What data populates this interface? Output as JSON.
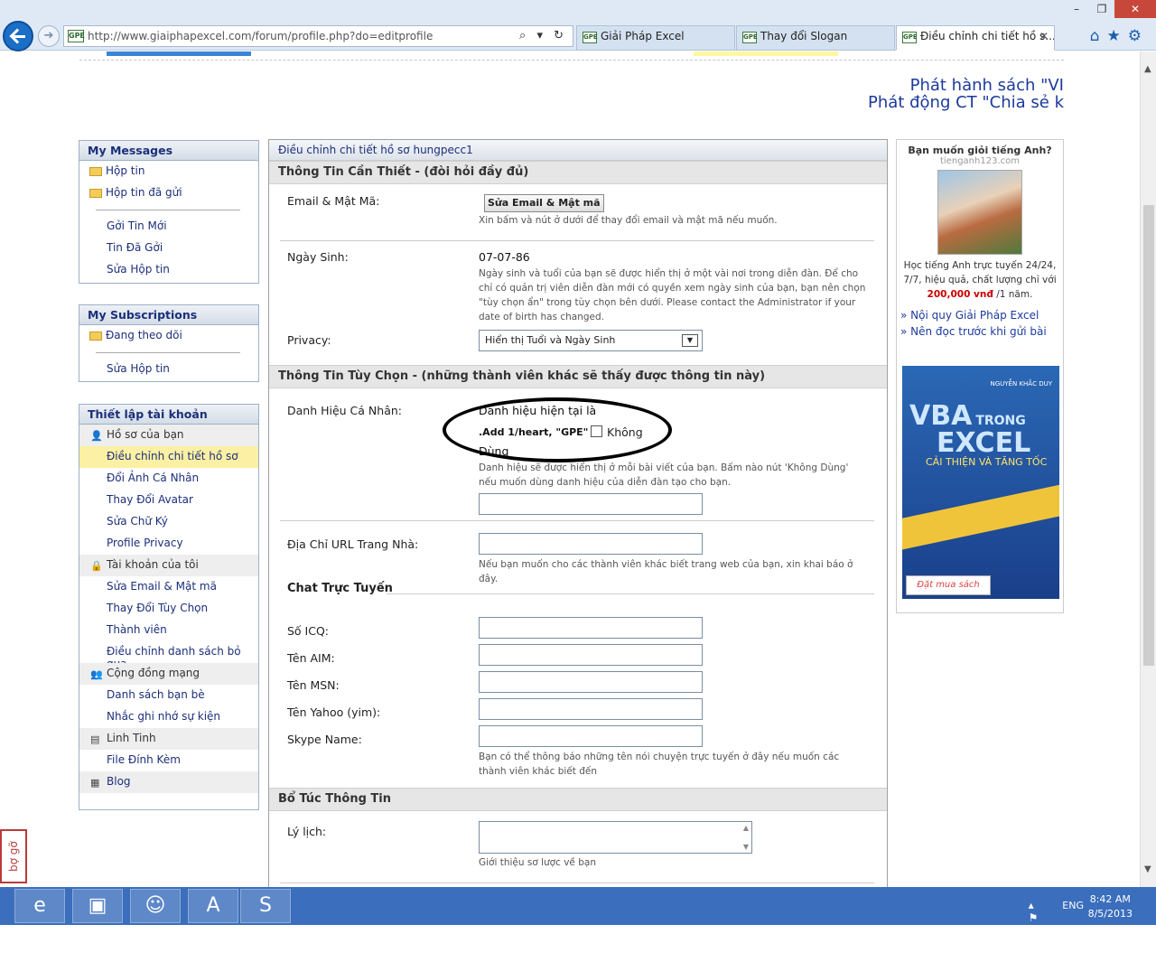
{
  "browser": {
    "url": "http://www.giaiphapexcel.com/forum/profile.php?do=editprofile",
    "tabs": [
      {
        "label": "Giải Pháp Excel"
      },
      {
        "label": "Thay đổi Slogan"
      },
      {
        "label": "Điều chỉnh chi tiết hồ s..."
      }
    ],
    "favicon_text": "GPE"
  },
  "banner": {
    "line1": "Phát hành sách \"VI",
    "line2": "Phát động CT \"Chia sẻ k"
  },
  "sidebar": {
    "messages": {
      "title": "My Messages",
      "items": [
        "Hộp tin",
        "Hộp tin đã gửi",
        "Gởi Tin Mới",
        "Tin Đã Gởi",
        "Sửa Hộp tin"
      ]
    },
    "subscriptions": {
      "title": "My Subscriptions",
      "items": [
        "Đang theo dõi",
        "Sửa Hộp tin"
      ]
    },
    "account": {
      "title": "Thiết lập tài khoản",
      "group_profile": "Hồ sơ của bạn",
      "profile_items": [
        "Điều chỉnh chi tiết hồ sơ",
        "Đổi Ảnh Cá Nhân",
        "Thay Đổi Avatar",
        "Sửa Chữ Ký",
        "Profile Privacy"
      ],
      "group_account": "Tài khoản của tôi",
      "account_items": [
        "Sửa Email & Mật mã",
        "Thay Đổi Tùy Chọn",
        "Thành viên",
        "Điều chỉnh danh sách bỏ qua"
      ],
      "group_community": "Cộng đồng mạng",
      "community_items": [
        "Danh sách bạn bè",
        "Nhắc ghi nhớ sự kiện"
      ],
      "group_misc": "Linh Tinh",
      "misc_items": [
        "File Đính Kèm"
      ],
      "group_blog": "Blog"
    }
  },
  "main": {
    "header": "Điều chỉnh chi tiết hồ sơ hungpecc1",
    "section_required": "Thông Tin Cần Thiết - (đòi hỏi đầy đủ)",
    "email_label": "Email & Mật Mã:",
    "email_button": "Sửa Email & Mật mã",
    "email_help": "Xin bấm và nút ở dưới để thay đổi email và mật mã nếu muốn.",
    "birthday_label": "Ngày Sinh:",
    "birthday_value": "07-07-86",
    "birthday_help": "Ngày sinh và tuổi của bạn sẽ được hiển thị ở một vài nơi trong diễn đàn. Để cho chỉ có quản trị viên diễn đàn mới có quyền xem ngày sinh của bạn, bạn nên chọn \"tùy chọn ẩn\" trong tùy chọn bên dưới. Please contact the Administrator if your date of birth has changed.",
    "privacy_label": "Privacy:",
    "privacy_value": "Hiển thị Tuổi và Ngày Sinh",
    "section_optional": "Thông Tin Tùy Chọn - (những thành viên khác sẽ thấy được thông tin này)",
    "title_label": "Danh Hiệu Cá Nhân:",
    "title_current_prefix": "Danh hiệu hiện tại là",
    "title_current_value": ".Add 1/heart, \"GPE\"",
    "title_none": "Không",
    "title_none_2": "Dùng",
    "title_help": "Danh hiệu sẽ được hiển thị ở mỗi bài viết của bạn. Bấm nào nút 'Không Dùng' nếu muốn dùng danh hiệu của diễn đàn tạo cho bạn.",
    "homepage_label": "Địa Chỉ URL Trang Nhà:",
    "homepage_help": "Nếu bạn muốn cho các thành viên khác biết trang web của bạn, xin khai báo ở đây.",
    "chat_heading": "Chat Trực Tuyến",
    "icq_label": "Số ICQ:",
    "aim_label": "Tên AIM:",
    "msn_label": "Tên MSN:",
    "yahoo_label": "Tên Yahoo (yim):",
    "skype_label": "Skype Name:",
    "chat_help": "Bạn có thể thông báo những tên nói chuyện trực tuyến ở đây nếu muốn các thành viên khác biết đến",
    "section_extra": "Bổ Túc Thông Tin",
    "bio_label": "Lý lịch:",
    "bio_help": "Giới thiệu sơ lược về bạn"
  },
  "right_ad": {
    "title": "Bạn muốn giỏi tiếng Anh?",
    "site": "tienganh123.com",
    "text": "Học tiếng Anh trực tuyến 24/24, 7/7, hiệu quả, chất lượng chỉ với",
    "price": "200,000 vnđ",
    "price_suffix": "/1 năm.",
    "link1": "» Nội quy Giải Pháp Excel",
    "link2": "» Nên đọc trước khi gửi bài",
    "book_author": "NGUYỄN KHẮC DUY",
    "book_title1": "VBA",
    "book_title_small": "TRONG",
    "book_title2": "EXCEL",
    "book_subtitle": "CẢI THIỆN VÀ TĂNG TỐC",
    "book_buy": "Đặt mua sách"
  },
  "bookmarklet": "bợ gỡ",
  "taskbar": {
    "lang": "ENG",
    "time": "8:42 AM",
    "date": "8/5/2013"
  }
}
